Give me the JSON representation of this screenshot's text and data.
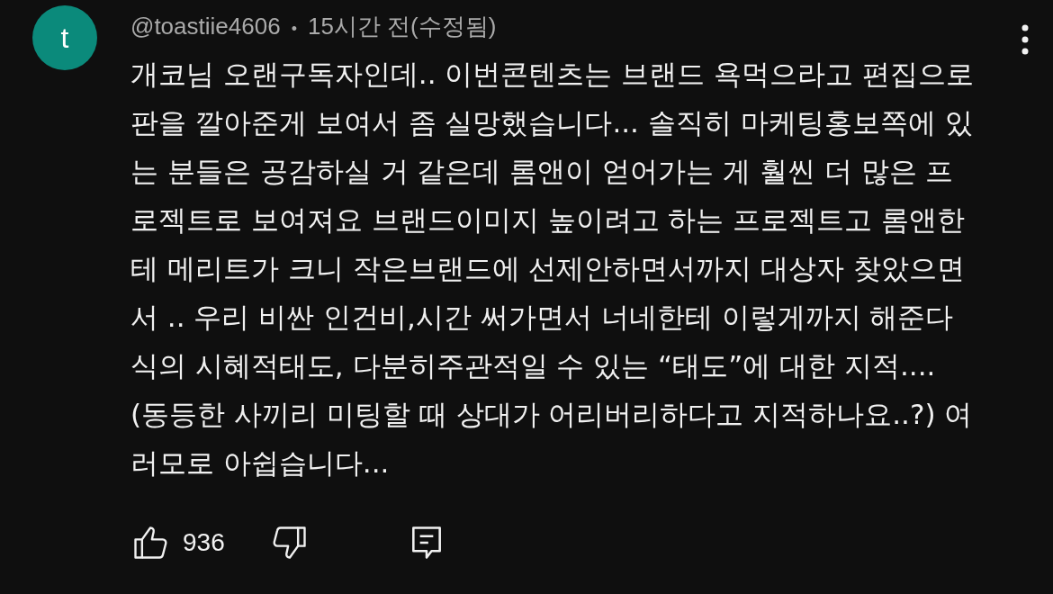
{
  "comment": {
    "avatar_letter": "t",
    "author": "@toastiie4606",
    "separator": "•",
    "time": "15시간 전(수정됨)",
    "text": "개코님 오랜구독자인데.. 이번콘텐츠는 브랜드 욕먹으라고 편집으로 판을 깔아준게 보여서 좀 실망했습니다... 솔직히 마케팅홍보쪽에 있는 분들은 공감하실 거 같은데 롬앤이 얻어가는 게 훨씬 더 많은 프로젝트로 보여져요 브랜드이미지 높이려고 하는 프로젝트고 롬앤한테 메리트가 크니 작은브랜드에 선제안하면서까지 대상자 찾았으면서 .. 우리 비싼 인건비,시간 써가면서 너네한테 이렇게까지 해준다 식의 시혜적태도, 다분히주관적일 수 있는 “태도”에 대한 지적.... (동등한 사끼리 미팅할 때 상대가 어리버리하다고 지적하나요..?) 여러모로 아쉽습니다...",
    "likes": "936"
  }
}
